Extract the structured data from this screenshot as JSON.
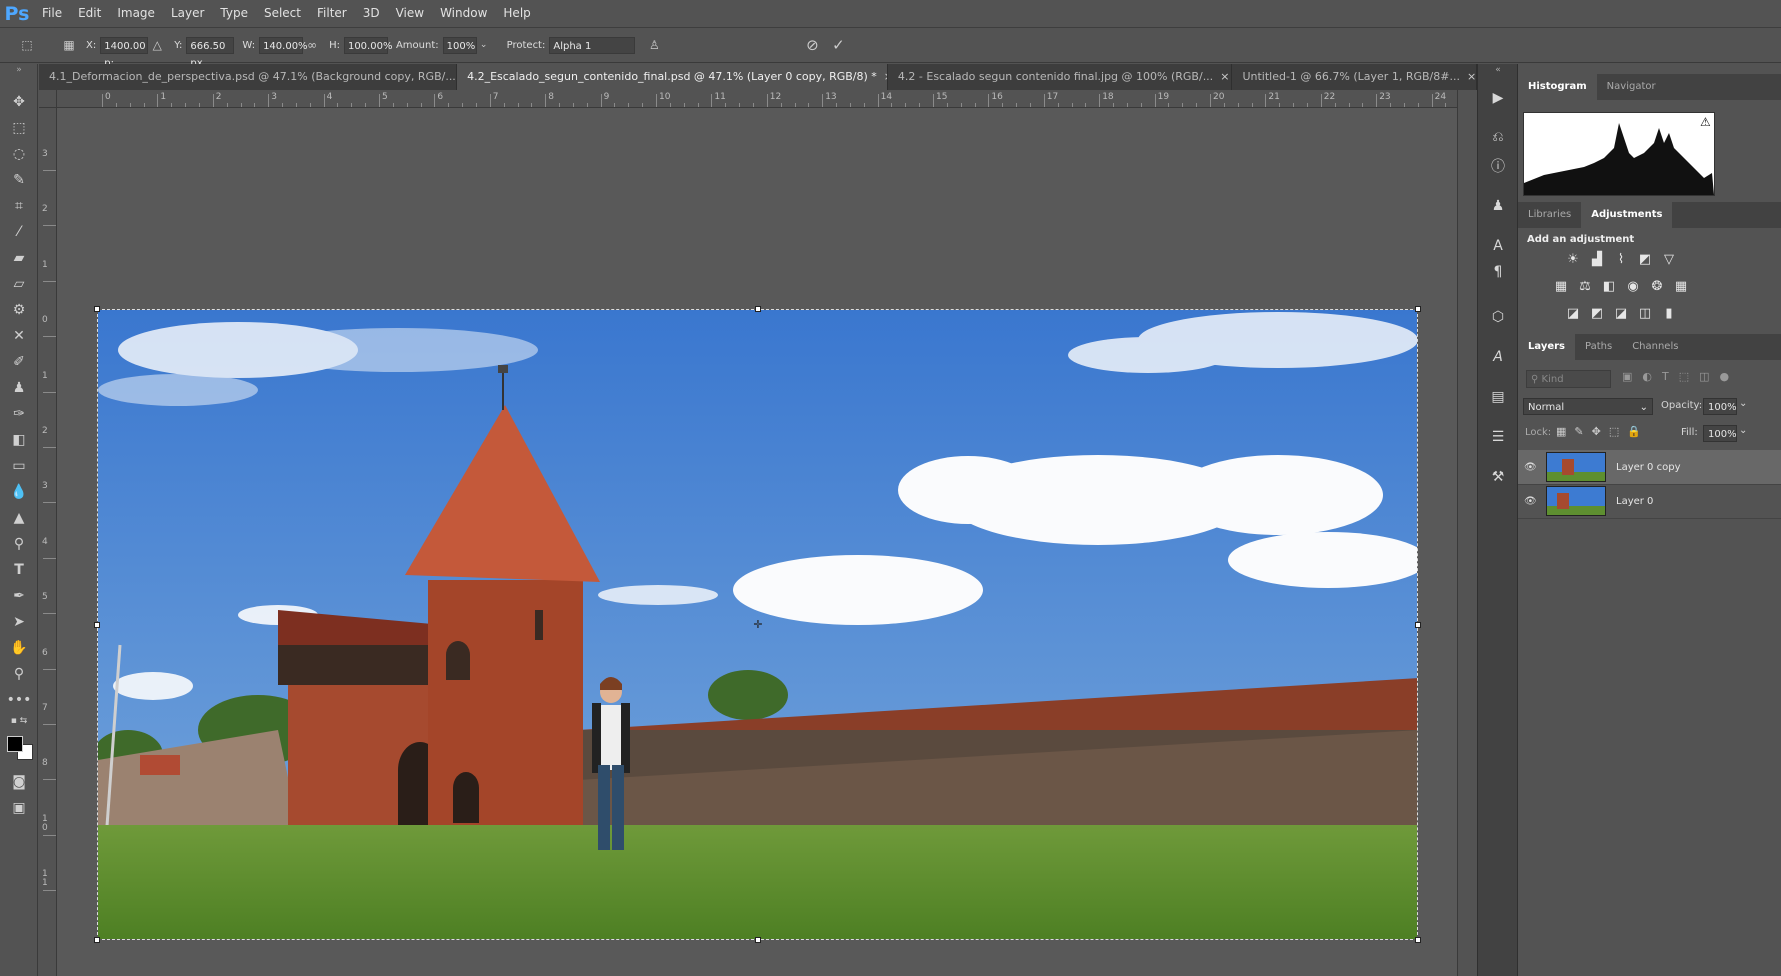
{
  "app": {
    "logo": "Ps"
  },
  "menu": [
    "File",
    "Edit",
    "Image",
    "Layer",
    "Type",
    "Select",
    "Filter",
    "3D",
    "View",
    "Window",
    "Help"
  ],
  "options": {
    "x_label": "X:",
    "x_value": "1400.00 p:",
    "y_label": "Y:",
    "y_value": "666.50 px",
    "w_label": "W:",
    "w_value": "140.00%",
    "h_label": "H:",
    "h_value": "100.00%",
    "amount_label": "Amount:",
    "amount_value": "100%",
    "protect_label": "Protect:",
    "protect_value": "Alpha 1",
    "cancel_icon": "cancel-circle-icon",
    "commit_icon": "checkmark-icon"
  },
  "tabs": [
    {
      "label": "4.1_Deformacion_de_perspectiva.psd @ 47.1% (Background copy, RGB/...",
      "active": false
    },
    {
      "label": "4.2_Escalado_segun_contenido_final.psd @ 47.1% (Layer 0 copy, RGB/8) *",
      "active": true
    },
    {
      "label": "4.2 - Escalado segun contenido final.jpg @ 100% (RGB/...",
      "active": false
    },
    {
      "label": "Untitled-1 @ 66.7% (Layer 1, RGB/8#...",
      "active": false
    }
  ],
  "ruler": {
    "h_numbers": [
      "0",
      "1",
      "2",
      "3",
      "4",
      "5",
      "6",
      "7",
      "8",
      "9",
      "10",
      "11",
      "12",
      "13",
      "14",
      "15",
      "16",
      "17",
      "18",
      "19",
      "20",
      "21",
      "22",
      "23",
      "24"
    ],
    "v_numbers": [
      "3",
      "2",
      "1",
      "0",
      "1",
      "2",
      "3",
      "4",
      "5",
      "6",
      "7",
      "8",
      "1 0",
      "1 1"
    ]
  },
  "histogram_panel": {
    "tabs": [
      "Histogram",
      "Navigator"
    ],
    "warning_icon": "warning-icon"
  },
  "adjustments_panel": {
    "tabs": [
      "Libraries",
      "Adjustments"
    ],
    "title": "Add an adjustment",
    "icons": [
      "brightness-icon",
      "levels-icon",
      "curves-icon",
      "exposure-icon",
      "vibrance-icon",
      "hue-saturation-icon",
      "color-balance-icon",
      "black-white-icon",
      "photo-filter-icon",
      "channel-mixer-icon",
      "color-lookup-icon",
      "invert-icon",
      "posterize-icon",
      "threshold-icon",
      "selective-color-icon",
      "gradient-map-icon"
    ]
  },
  "layers_panel": {
    "tabs": [
      "Layers",
      "Paths",
      "Channels"
    ],
    "kind_placeholder": "Kind",
    "blend_mode": "Normal",
    "opacity_label": "Opacity:",
    "opacity_value": "100%",
    "lock_label": "Lock:",
    "fill_label": "Fill:",
    "fill_value": "100%",
    "layers": [
      {
        "name": "Layer 0 copy",
        "selected": true
      },
      {
        "name": "Layer 0",
        "selected": false
      }
    ]
  },
  "colors": {
    "accent_logo": "#4ea7ff",
    "ui_bg": "#535353",
    "panel_dark": "#424242",
    "sky": "#3d7bd2",
    "grass": "#5e8f30",
    "brick": "#a64a2f"
  }
}
